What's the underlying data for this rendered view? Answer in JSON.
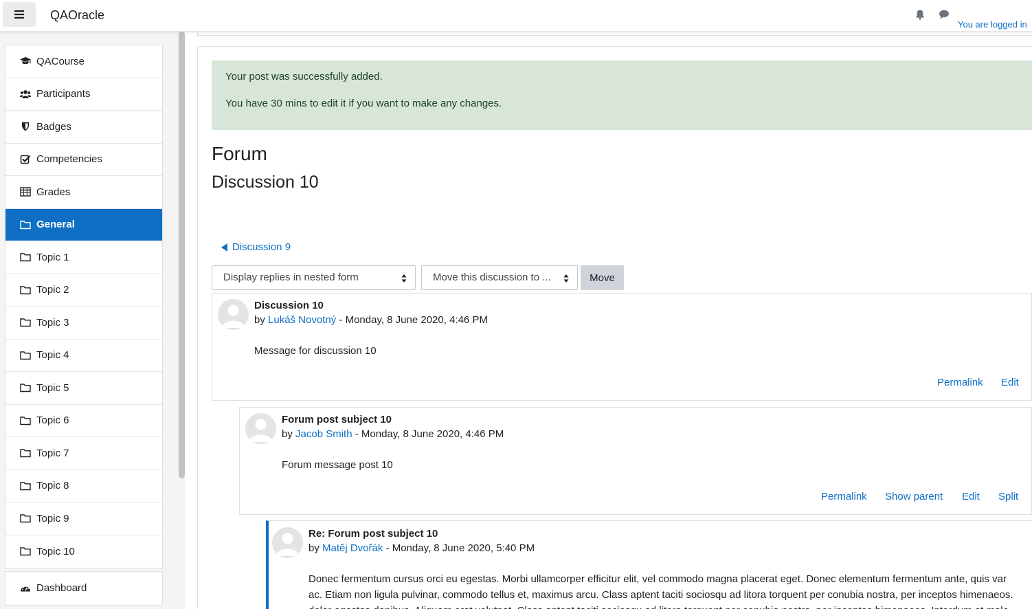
{
  "navbar": {
    "brand": "QAOracle",
    "login_text": "You are logged in"
  },
  "drawer": {
    "items": [
      {
        "label": "QACourse",
        "icon": "graduation-cap-icon"
      },
      {
        "label": "Participants",
        "icon": "users-icon"
      },
      {
        "label": "Badges",
        "icon": "shield-icon"
      },
      {
        "label": "Competencies",
        "icon": "checkbox-icon"
      },
      {
        "label": "Grades",
        "icon": "table-icon"
      },
      {
        "label": "General",
        "icon": "folder-icon",
        "active": true
      },
      {
        "label": "Topic 1",
        "icon": "folder-icon"
      },
      {
        "label": "Topic 2",
        "icon": "folder-icon"
      },
      {
        "label": "Topic 3",
        "icon": "folder-icon"
      },
      {
        "label": "Topic 4",
        "icon": "folder-icon"
      },
      {
        "label": "Topic 5",
        "icon": "folder-icon"
      },
      {
        "label": "Topic 6",
        "icon": "folder-icon"
      },
      {
        "label": "Topic 7",
        "icon": "folder-icon"
      },
      {
        "label": "Topic 8",
        "icon": "folder-icon"
      },
      {
        "label": "Topic 9",
        "icon": "folder-icon"
      },
      {
        "label": "Topic 10",
        "icon": "folder-icon"
      }
    ],
    "dashboard": {
      "label": "Dashboard",
      "icon": "dashboard-icon"
    }
  },
  "alert": {
    "line1": "Your post was successfully added.",
    "line2": "You have 30 mins to edit it if you want to make any changes."
  },
  "page": {
    "heading": "Forum",
    "subheading": "Discussion 10",
    "prev_link": "Discussion 9"
  },
  "controls": {
    "display_mode": "Display replies in nested form",
    "move_select": "Move this discussion to ...",
    "move_button": "Move"
  },
  "posts": [
    {
      "subject": "Discussion 10",
      "by": "by",
      "author": "Lukáš Novotný",
      "date": "- Monday, 8 June 2020, 4:46 PM",
      "message": "Message for discussion 10",
      "commands": [
        "Permalink",
        "Edit"
      ]
    },
    {
      "subject": "Forum post subject 10",
      "by": "by",
      "author": "Jacob Smith",
      "date": "- Monday, 8 June 2020, 4:46 PM",
      "message": "Forum message post 10",
      "commands": [
        "Permalink",
        "Show parent",
        "Edit",
        "Split"
      ]
    },
    {
      "subject": "Re: Forum post subject 10",
      "by": "by",
      "author": "Matěj Dvořák",
      "date": "- Monday, 8 June 2020, 5:40 PM",
      "message_line1": "Donec fermentum cursus orci eu egestas. Morbi ullamcorper efficitur elit, vel commodo magna placerat eget. Donec elementum fermentum ante, quis var",
      "message_line2": "ac. Etiam non ligula pulvinar, commodo tellus et, maximus arcu. Class aptent taciti sociosqu ad litora torquent per conubia nostra, per inceptos himenaeos.",
      "message_line3": "dolor egestas dapibus. Aliquam erat volutpat. Class aptent taciti sociosqu ad litora torquent per conubia nostra, per inceptos himenaeos. Interdum et male"
    }
  ]
}
